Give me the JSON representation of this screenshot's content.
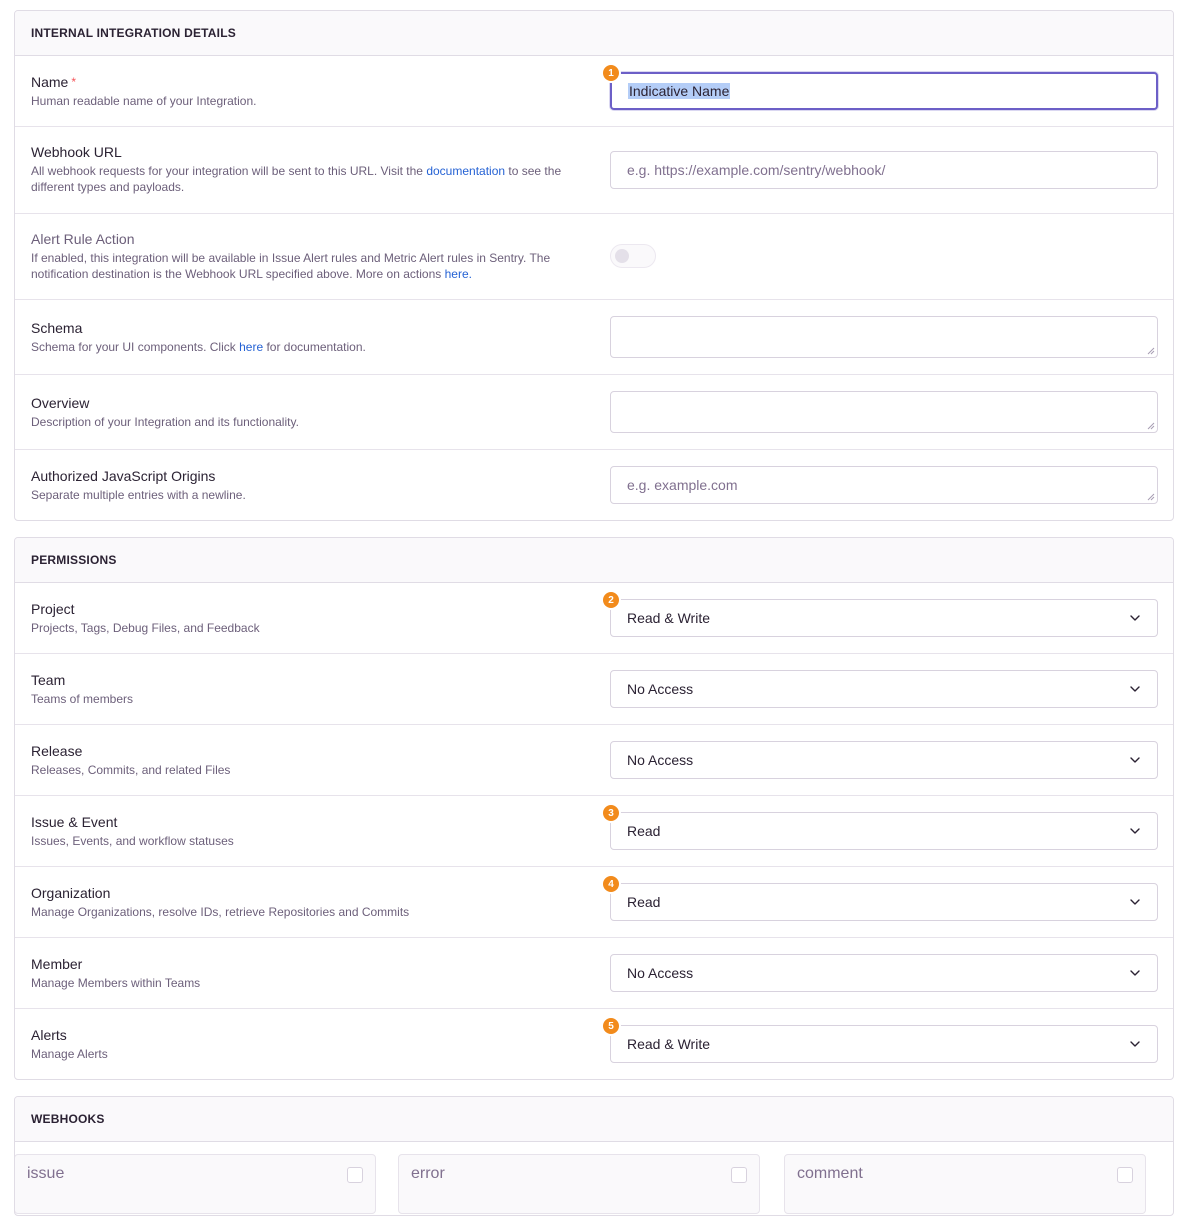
{
  "details": {
    "header": "INTERNAL INTEGRATION DETAILS",
    "name": {
      "label": "Name",
      "required_mark": "*",
      "help": "Human readable name of your Integration.",
      "value": "Indicative Name",
      "badge": "1"
    },
    "webhook": {
      "label": "Webhook URL",
      "help_before": "All webhook requests for your integration will be sent to this URL. Visit the",
      "help_link": "documentation",
      "help_after": "to see the different types and payloads.",
      "placeholder": "e.g. https://example.com/sentry/webhook/"
    },
    "alert_rule": {
      "label": "Alert Rule Action",
      "help_before": "If enabled, this integration will be available in Issue Alert rules and Metric Alert rules in Sentry. The notification destination is the Webhook URL specified above. More on actions",
      "help_link": "here.",
      "enabled": false
    },
    "schema": {
      "label": "Schema",
      "help_before": "Schema for your UI components. Click",
      "help_link": "here",
      "help_after": "for documentation."
    },
    "overview": {
      "label": "Overview",
      "help": "Description of your Integration and its functionality."
    },
    "origins": {
      "label": "Authorized JavaScript Origins",
      "help": "Separate multiple entries with a newline.",
      "placeholder": "e.g. example.com"
    }
  },
  "permissions": {
    "header": "PERMISSIONS",
    "rows": [
      {
        "label": "Project",
        "help": "Projects, Tags, Debug Files, and Feedback",
        "value": "Read & Write",
        "badge": "2"
      },
      {
        "label": "Team",
        "help": "Teams of members",
        "value": "No Access",
        "badge": ""
      },
      {
        "label": "Release",
        "help": "Releases, Commits, and related Files",
        "value": "No Access",
        "badge": ""
      },
      {
        "label": "Issue & Event",
        "help": "Issues, Events, and workflow statuses",
        "value": "Read",
        "badge": "3"
      },
      {
        "label": "Organization",
        "help": "Manage Organizations, resolve IDs, retrieve Repositories and Commits",
        "value": "Read",
        "badge": "4"
      },
      {
        "label": "Member",
        "help": "Manage Members within Teams",
        "value": "No Access",
        "badge": ""
      },
      {
        "label": "Alerts",
        "help": "Manage Alerts",
        "value": "Read & Write",
        "badge": "5"
      }
    ]
  },
  "webhooks": {
    "header": "WEBHOOKS",
    "cards": [
      "issue",
      "error",
      "comment"
    ]
  },
  "colors": {
    "accent": "#6c5fc7",
    "badge": "#f28b1c",
    "link": "#2562d4",
    "required": "#f55459"
  }
}
